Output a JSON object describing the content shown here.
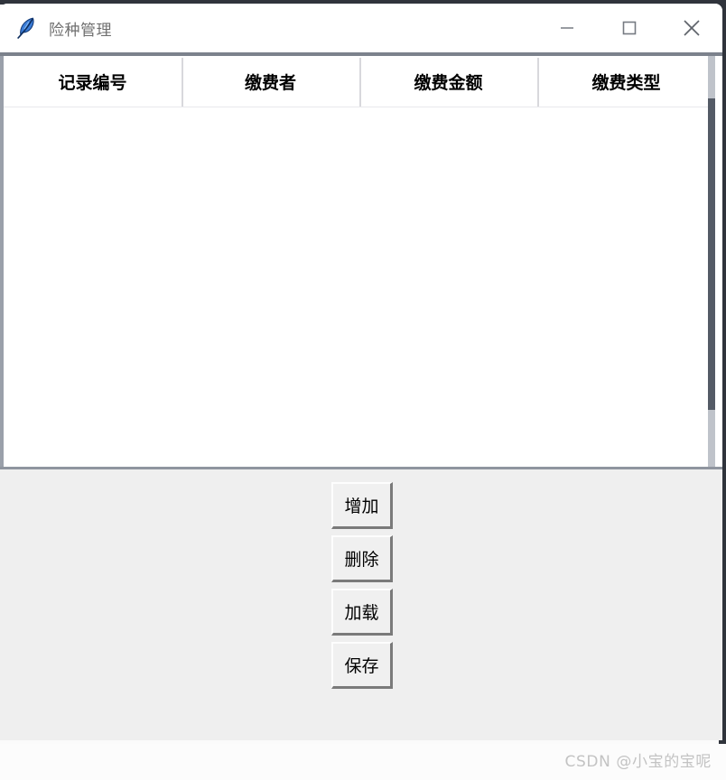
{
  "window": {
    "title": "险种管理",
    "icon": "feather-icon",
    "controls": [
      {
        "name": "minimize-button",
        "glyph": "minimize-icon",
        "label": "—"
      },
      {
        "name": "maximize-button",
        "glyph": "maximize-icon",
        "label": "□"
      },
      {
        "name": "close-button",
        "glyph": "close-icon",
        "label": "✕"
      }
    ]
  },
  "table": {
    "columns": [
      {
        "label": "记录编号"
      },
      {
        "label": "缴费者"
      },
      {
        "label": "缴费金额"
      },
      {
        "label": "缴费类型"
      }
    ],
    "rows": []
  },
  "scrollbar": {
    "name": "vertical-scrollbar",
    "orientation": "vertical"
  },
  "actions": {
    "buttons": [
      {
        "name": "add-button",
        "label": "增加"
      },
      {
        "name": "delete-button",
        "label": "删除"
      },
      {
        "name": "load-button",
        "label": "加载"
      },
      {
        "name": "save-button",
        "label": "保存"
      }
    ]
  },
  "watermark": {
    "text": "CSDN @小宝的宝呢"
  },
  "colors": {
    "window_border": "#30343c",
    "titlebar_bg": "#ffffff",
    "title_text": "#6f6f6f",
    "divider": "#7c828c",
    "panel_bg": "#efefef",
    "scroll_thumb": "#545b66",
    "watermark": "#c3c3c3"
  }
}
